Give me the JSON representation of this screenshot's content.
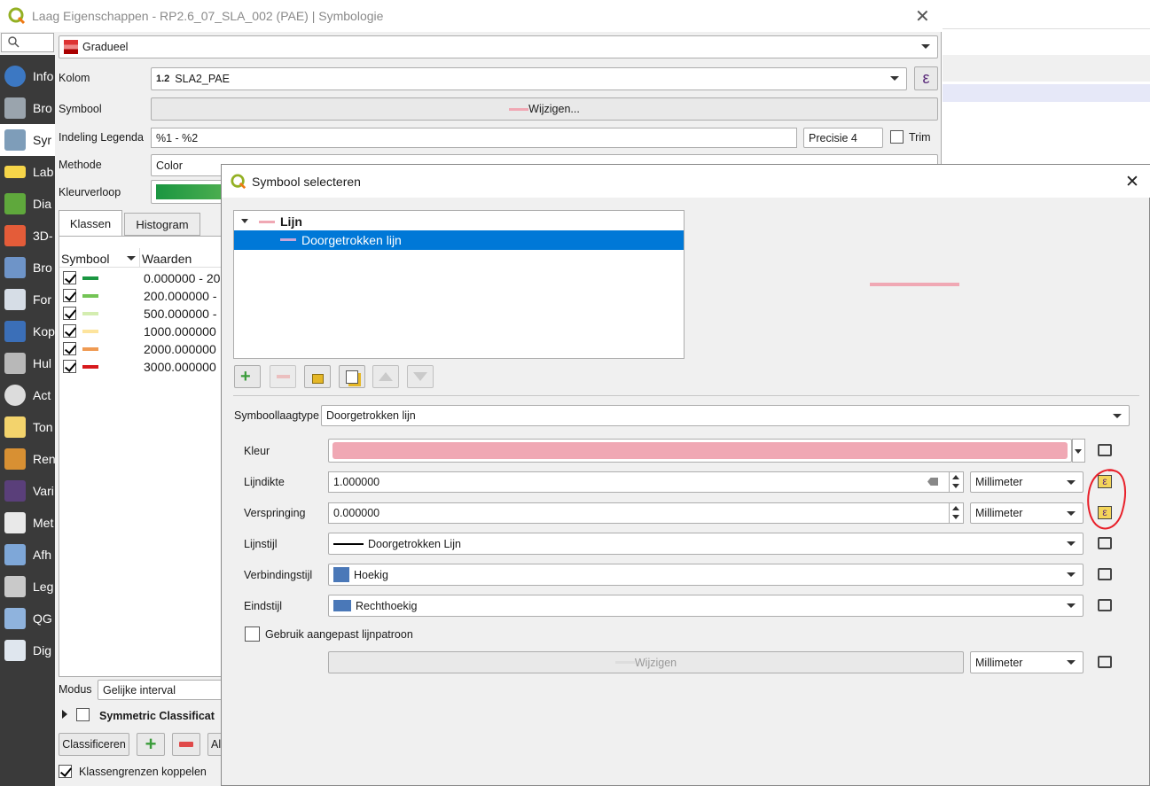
{
  "main_window": {
    "title": "Laag Eigenschappen - RP2.6_07_SLA_002 (PAE) | Symbologie",
    "search_placeholder": ""
  },
  "sidebar": {
    "items": [
      "Info",
      "Bro",
      "Syr",
      "Lab",
      "Dia",
      "3D-",
      "Bro",
      "For",
      "Kop",
      "Hul",
      "Act",
      "Ton",
      "Ren",
      "Vari",
      "Met",
      "Afh",
      "Leg",
      "QG",
      "Dig"
    ]
  },
  "renderer": {
    "type": "Gradueel"
  },
  "form": {
    "kolom_label": "Kolom",
    "kolom_prefix": "1.2",
    "kolom_value": "SLA2_PAE",
    "symbool_label": "Symbool",
    "symbool_btn": "Wijzigen...",
    "legend_label": "Indeling Legenda",
    "legend_value": "%1 - %2",
    "precisie": "Precisie 4",
    "trim": "Trim",
    "methode_label": "Methode",
    "methode_value": "Color",
    "kleurverloop_label": "Kleurverloop"
  },
  "tabs": {
    "klassen": "Klassen",
    "histogram": "Histogram"
  },
  "class_table": {
    "col_symbool": "Symbool",
    "col_waarden": "Waarden",
    "rows": [
      {
        "value": "0.000000 - 20",
        "color": "#1a9641"
      },
      {
        "value": "200.000000 -",
        "color": "#73c455"
      },
      {
        "value": "500.000000 -",
        "color": "#d4edb0"
      },
      {
        "value": "1000.000000",
        "color": "#fde49d"
      },
      {
        "value": "2000.000000",
        "color": "#ef9a52"
      },
      {
        "value": "3000.000000",
        "color": "#d7191c"
      }
    ]
  },
  "bottom": {
    "modus_label": "Modus",
    "modus_value": "Gelijke interval",
    "symmetric": "Symmetric Classificat",
    "classificeren": "Classificeren",
    "al": "Al",
    "klassengrenzen": "Klassengrenzen koppelen"
  },
  "dialog": {
    "title": "Symbool selecteren",
    "tree_root": "Lijn",
    "tree_child": "Doorgetrokken lijn",
    "symboollaagtype_label": "Symboollaagtype",
    "symboollaagtype_value": "Doorgetrokken lijn",
    "kleur_label": "Kleur",
    "kleur_color": "#f0a8b4",
    "lijndikte_label": "Lijndikte",
    "lijndikte_value": "1.000000",
    "lijndikte_unit": "Millimeter",
    "verspringing_label": "Verspringing",
    "verspringing_value": "0.000000",
    "verspringing_unit": "Millimeter",
    "lijnstijl_label": "Lijnstijl",
    "lijnstijl_value": "Doorgetrokken Lijn",
    "verbinding_label": "Verbindingstijl",
    "verbinding_value": "Hoekig",
    "eindstijl_label": "Eindstijl",
    "eindstijl_value": "Rechthoekig",
    "patroon_label": "Gebruik aangepast lijnpatroon",
    "patroon_btn": "Wijzigen",
    "patroon_unit": "Millimeter"
  },
  "colors": {
    "accent": "#0078d7",
    "sidebar_bg": "#3a3a3a",
    "annotation_red": "#e8202a",
    "symbol_pink": "#f0a8b4"
  }
}
